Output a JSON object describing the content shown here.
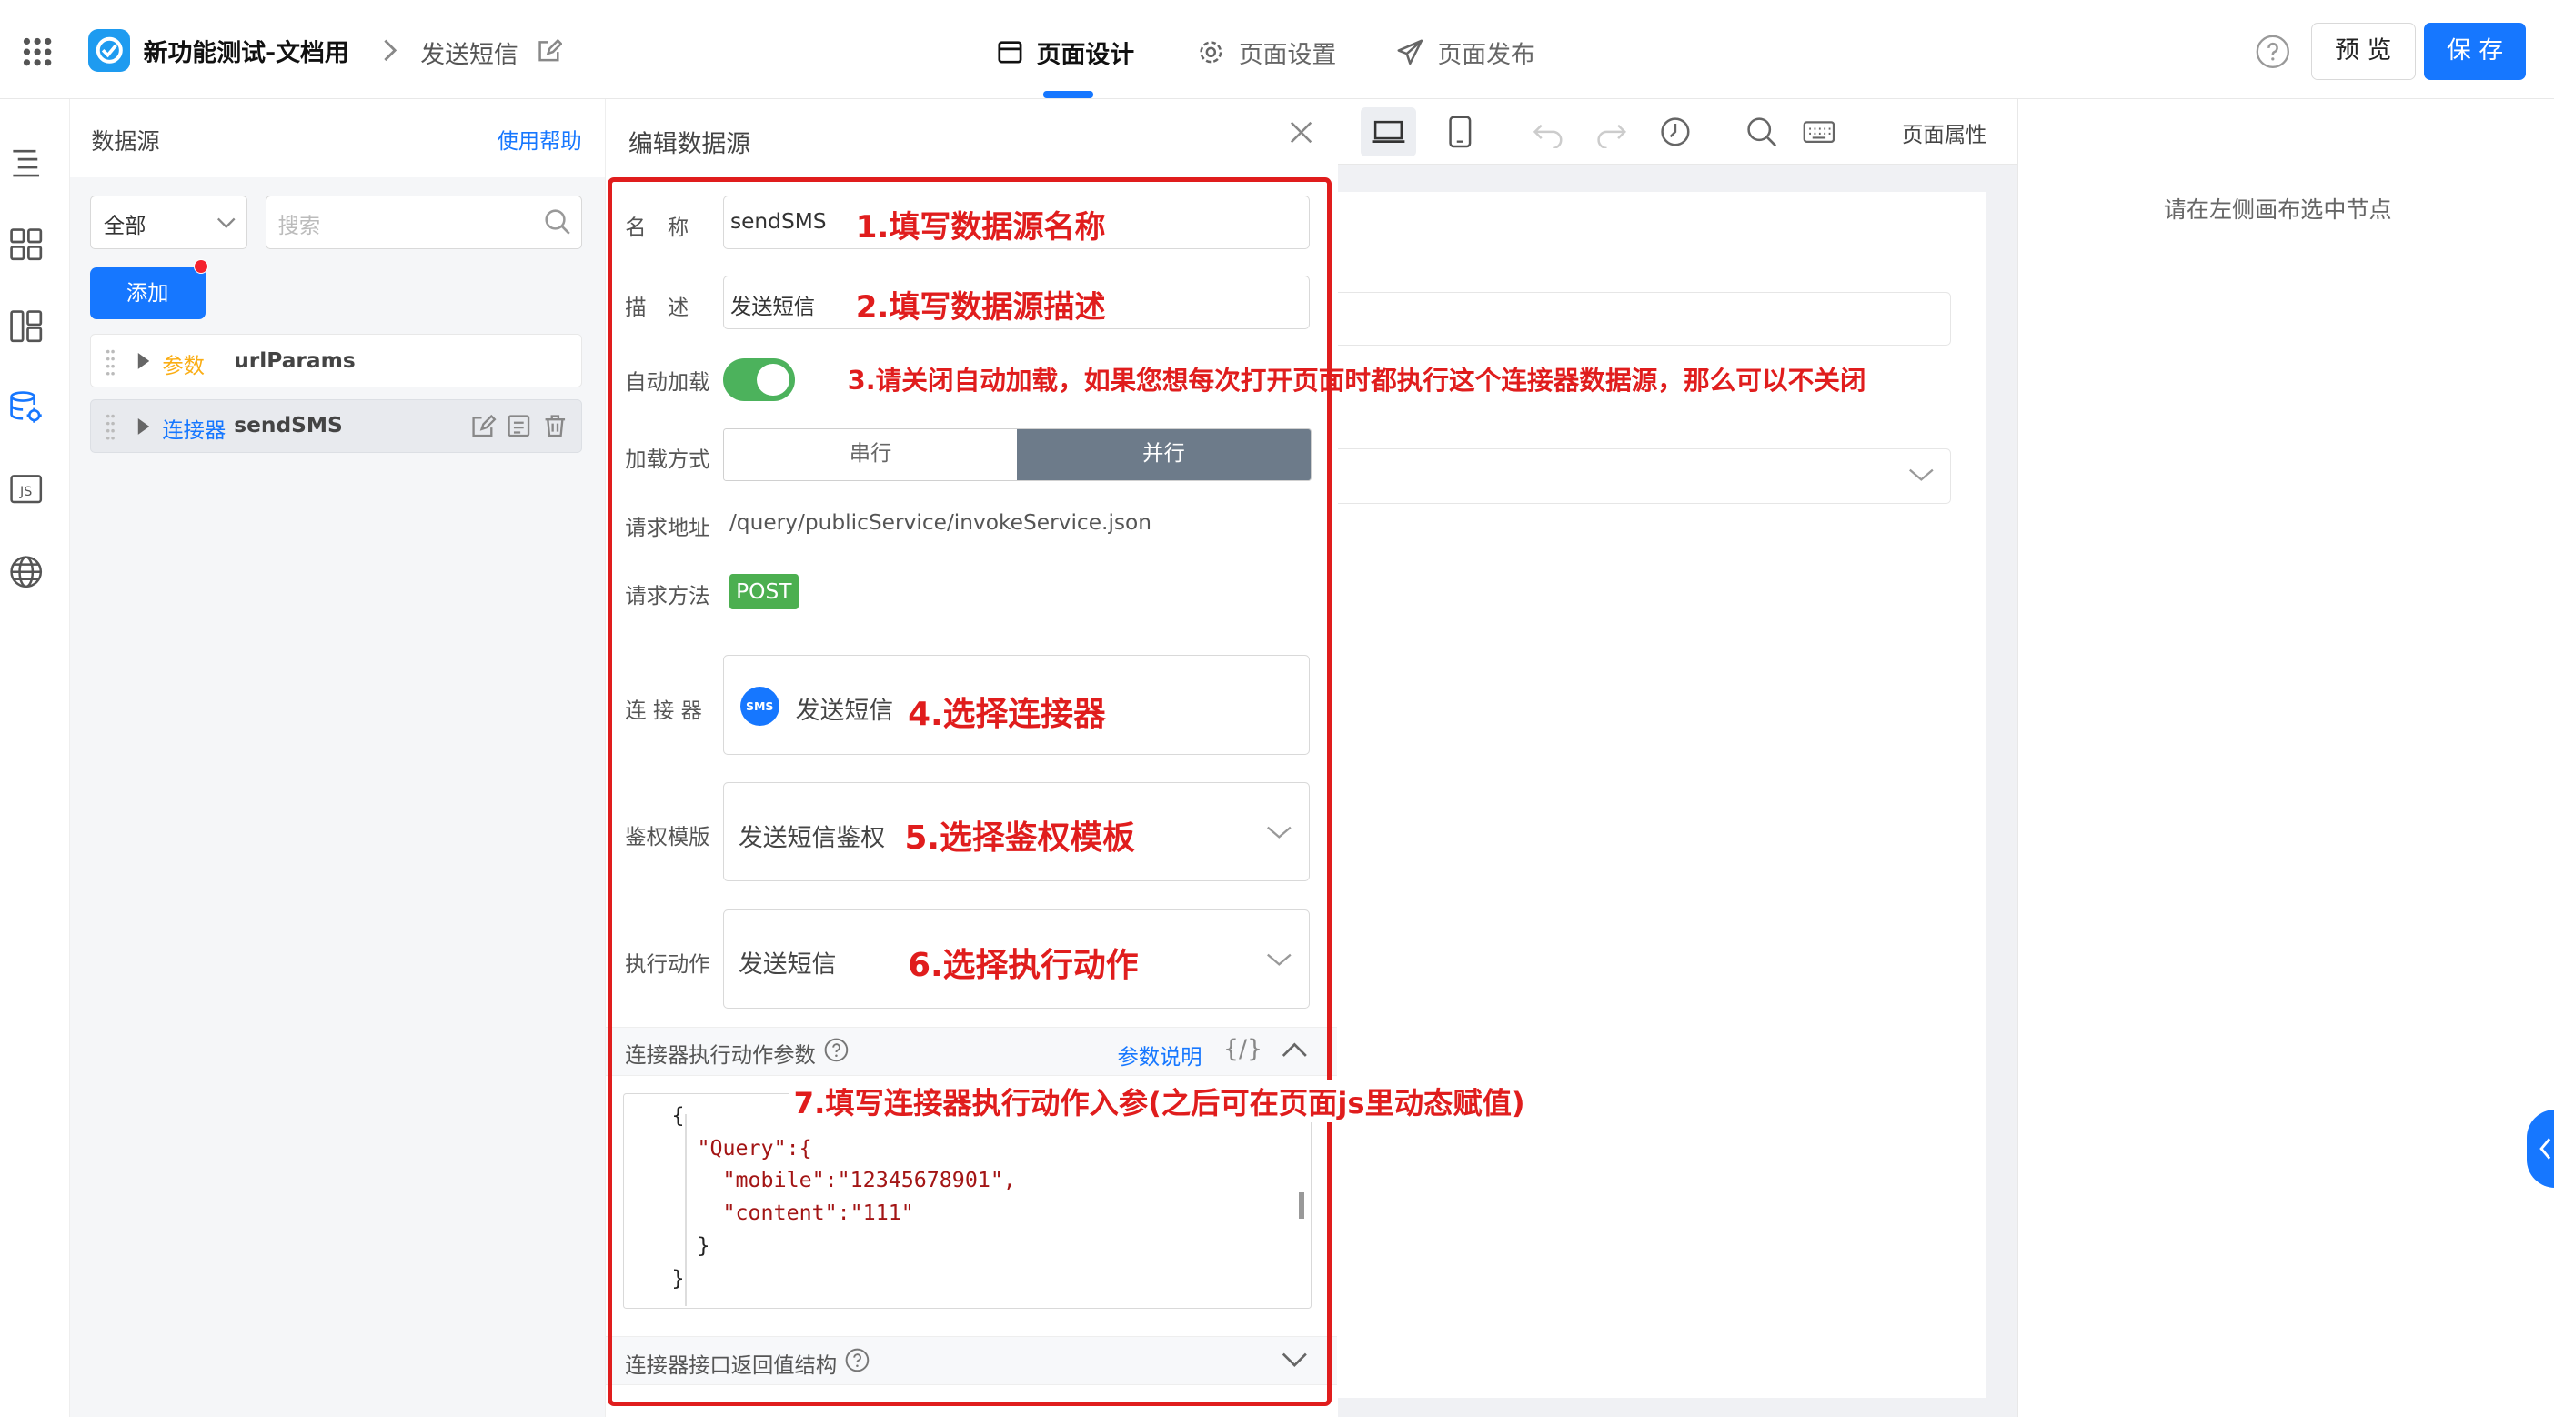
{
  "header": {
    "app_title": "新功能测试-文档用",
    "page_name": "发送短信",
    "tabs": [
      {
        "label": "页面设计",
        "active": true
      },
      {
        "label": "页面设置"
      },
      {
        "label": "页面发布"
      }
    ],
    "preview_label": "预 览",
    "save_label": "保 存"
  },
  "datasource_panel": {
    "title": "数据源",
    "help_link": "使用帮助",
    "filter_value": "全部",
    "search_placeholder": "搜索",
    "add_label": "添加",
    "items": [
      {
        "type_label": "参数",
        "name": "urlParams"
      },
      {
        "type_label": "连接器",
        "name": "sendSMS"
      }
    ]
  },
  "editor": {
    "title": "编辑数据源",
    "name_label": "名　称",
    "name_value": "sendSMS",
    "desc_label": "描　述",
    "desc_value": "发送短信",
    "autoload_label": "自动加载",
    "autoload_on": true,
    "load_mode_label": "加载方式",
    "load_modes": [
      "串行",
      "并行"
    ],
    "load_mode_selected": "并行",
    "url_label": "请求地址",
    "url_value": "/query/publicService/invokeService.json",
    "method_label": "请求方法",
    "method_value": "POST",
    "connector_label": "连 接 器",
    "connector_badge": "SMS",
    "connector_value": "发送短信",
    "auth_label": "鉴权模版",
    "auth_value": "发送短信鉴权",
    "action_label": "执行动作",
    "action_value": "发送短信",
    "params_label": "连接器执行动作参数",
    "params_help": "参数说明",
    "params_code_toggle": "{/}",
    "code_lines": [
      "{",
      "  \"Query\":{",
      "    \"mobile\":\"12345678901\",",
      "    \"content\":\"111\"",
      "  }",
      "}"
    ],
    "return_label": "连接器接口返回值结构"
  },
  "annotations": {
    "a1": "1.填写数据源名称",
    "a2": "2.填写数据源描述",
    "a3": "3.请关闭自动加载，如果您想每次打开页面时都执行这个连接器数据源，那么可以不关闭",
    "a4": "4.选择连接器",
    "a5": "5.选择鉴权模板",
    "a6": "6.选择执行动作",
    "a7": "7.填写连接器执行动作入参(之后可在页面js里动态赋值)"
  },
  "canvas_toolbar": {
    "page_props": "页面属性"
  },
  "right_panel": {
    "hint": "请在左侧画布选中节点"
  },
  "colors": {
    "primary": "#1677ff",
    "accent_red": "#e01d1d",
    "success": "#52c41a",
    "toggle": "#4cb25c",
    "segment_active": "#6d7b8a"
  }
}
